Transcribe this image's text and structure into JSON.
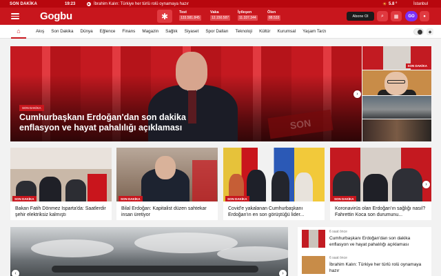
{
  "ticker": {
    "tag": "SON DAKİKA",
    "time": "19:23",
    "headline": "İbrahim Kalın: Türkiye her türlü rolü oynamaya hazır",
    "temperature": "5.8 °",
    "city": "İstanbul"
  },
  "header": {
    "logo": "Gogbu",
    "stats": [
      {
        "label": "Test",
        "value": "133.581.845"
      },
      {
        "label": "Vaka",
        "value": "12.150.587"
      },
      {
        "label": "İyileşen",
        "value": "11.337.344"
      },
      {
        "label": "Ölen",
        "value": "88.533"
      }
    ],
    "subscribe_label": "Abone Ol",
    "go_label": "GO"
  },
  "nav": {
    "items": [
      "Akış",
      "Son Dakika",
      "Dünya",
      "Eğlence",
      "Finans",
      "Magazin",
      "Sağlık",
      "Siyaset",
      "Spor Dalları",
      "Teknoloji",
      "Kültür",
      "Kurumsal",
      "Yaşam Tarzı"
    ]
  },
  "hero": {
    "badge": "SON DAKİKA",
    "title": "Cumhurbaşkanı Erdoğan'dan son dakika enflasyon ve hayat pahalılığı açıklaması",
    "stamp": "SON"
  },
  "side_thumbs": {
    "first_label": "SON DAKİKA"
  },
  "cards": [
    {
      "badge": "SON DAKİKA",
      "title": "Bakan Fatih Dönmez Isparta'da: Saatlerdir şehir elektriksiz kalmıştı"
    },
    {
      "badge": "SON DAKİKA",
      "title": "Bilal Erdoğan: Kapitalist düzen sahtekar insan üretiyor"
    },
    {
      "badge": "SON DAKİKA",
      "title": "Covid'e yakalanan Cumhurbaşkanı Erdoğan'ın en son görüştüğü lider..."
    },
    {
      "badge": "SON DAKİKA",
      "title": "Koronavirüs olan Erdoğan'ın sağlığı nasıl? Fahrettin Koca son durumunu..."
    }
  ],
  "news_list": [
    {
      "time": "6 saat önce",
      "title": "Cumhurbaşkanı Erdoğan'dan son dakika enflasyon ve hayat pahalılığı açıklaması"
    },
    {
      "time": "6 saat önce",
      "title": "İbrahim Kalın: Türkiye her türlü rolü oynamaya hazır"
    }
  ],
  "colors": {
    "brand_red": "#c8161d",
    "dark_red": "#b8070e"
  }
}
